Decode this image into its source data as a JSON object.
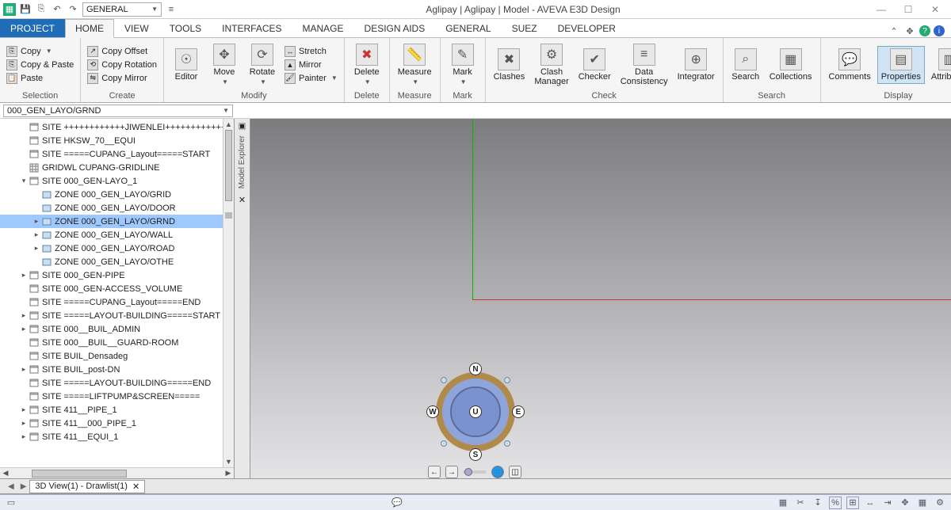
{
  "title": "Aglipay | Aglipay | Model - AVEVA E3D Design",
  "qat_dropdown": "GENERAL",
  "tabs": {
    "project": "PROJECT",
    "items": [
      "HOME",
      "VIEW",
      "TOOLS",
      "INTERFACES",
      "MANAGE",
      "DESIGN AIDS",
      "GENERAL",
      "SUEZ",
      "DEVELOPER"
    ],
    "active": 0
  },
  "ribbon": {
    "selection": {
      "label": "Selection",
      "copy": "Copy",
      "copypaste": "Copy & Paste",
      "paste": "Paste"
    },
    "create": {
      "label": "Create",
      "copyoffset": "Copy Offset",
      "copyrotation": "Copy Rotation",
      "copymirror": "Copy Mirror"
    },
    "modify": {
      "label": "Modify",
      "editor": "Editor",
      "move": "Move",
      "rotate": "Rotate",
      "stretch": "Stretch",
      "mirror": "Mirror",
      "painter": "Painter"
    },
    "delete": {
      "label": "Delete",
      "btn": "Delete"
    },
    "measure": {
      "label": "Measure",
      "btn": "Measure"
    },
    "mark": {
      "label": "Mark",
      "btn": "Mark"
    },
    "check": {
      "label": "Check",
      "clashes": "Clashes",
      "clashmgr": "Clash\nManager",
      "checker": "Checker",
      "datacons": "Data\nConsistency",
      "integrator": "Integrator"
    },
    "search": {
      "label": "Search",
      "search": "Search",
      "collections": "Collections"
    },
    "display": {
      "label": "Display",
      "comments": "Comments",
      "properties": "Properties",
      "attributes": "Attributes"
    }
  },
  "path": "000_GEN_LAYO/GRND",
  "sidepanel": {
    "label": "Model Explorer"
  },
  "tree": [
    {
      "d": 1,
      "t": "",
      "exp": "",
      "ic": "site",
      "label": "SITE ++++++++++++JIWENLEI++++++++++++"
    },
    {
      "d": 1,
      "t": "",
      "exp": "",
      "ic": "site",
      "label": "SITE HKSW_70__EQUI"
    },
    {
      "d": 1,
      "t": "",
      "exp": "",
      "ic": "site",
      "label": "SITE =====CUPANG_Layout=====START"
    },
    {
      "d": 1,
      "t": "",
      "exp": "",
      "ic": "grid",
      "label": "GRIDWL CUPANG-GRIDLINE"
    },
    {
      "d": 1,
      "t": "▾",
      "exp": "open",
      "ic": "site",
      "label": "SITE 000_GEN-LAYO_1"
    },
    {
      "d": 2,
      "t": "",
      "exp": "",
      "ic": "zone",
      "label": "ZONE 000_GEN_LAYO/GRID"
    },
    {
      "d": 2,
      "t": "",
      "exp": "",
      "ic": "zone",
      "label": "ZONE 000_GEN_LAYO/DOOR"
    },
    {
      "d": 2,
      "t": "▸",
      "exp": "closed",
      "ic": "zone",
      "label": "ZONE 000_GEN_LAYO/GRND",
      "sel": true
    },
    {
      "d": 2,
      "t": "▸",
      "exp": "closed",
      "ic": "zone",
      "label": "ZONE 000_GEN_LAYO/WALL"
    },
    {
      "d": 2,
      "t": "▸",
      "exp": "closed",
      "ic": "zone",
      "label": "ZONE 000_GEN_LAYO/ROAD"
    },
    {
      "d": 2,
      "t": "",
      "exp": "",
      "ic": "zone",
      "label": "ZONE 000_GEN_LAYO/OTHE"
    },
    {
      "d": 1,
      "t": "▸",
      "exp": "closed",
      "ic": "site",
      "label": "SITE 000_GEN-PIPE"
    },
    {
      "d": 1,
      "t": "",
      "exp": "",
      "ic": "site",
      "label": "SITE 000_GEN-ACCESS_VOLUME"
    },
    {
      "d": 1,
      "t": "",
      "exp": "",
      "ic": "site",
      "label": "SITE =====CUPANG_Layout=====END"
    },
    {
      "d": 1,
      "t": "▸",
      "exp": "closed",
      "ic": "site",
      "label": "SITE =====LAYOUT-BUILDING=====START"
    },
    {
      "d": 1,
      "t": "▸",
      "exp": "closed",
      "ic": "site",
      "label": "SITE 000__BUIL_ADMIN"
    },
    {
      "d": 1,
      "t": "",
      "exp": "",
      "ic": "site",
      "label": "SITE 000__BUIL__GUARD-ROOM"
    },
    {
      "d": 1,
      "t": "",
      "exp": "",
      "ic": "site",
      "label": "SITE BUIL_Densadeg"
    },
    {
      "d": 1,
      "t": "▸",
      "exp": "closed",
      "ic": "site",
      "label": "SITE BUIL_post-DN"
    },
    {
      "d": 1,
      "t": "",
      "exp": "",
      "ic": "site",
      "label": "SITE =====LAYOUT-BUILDING=====END"
    },
    {
      "d": 1,
      "t": "",
      "exp": "",
      "ic": "site",
      "label": "SITE =====LIFTPUMP&SCREEN====="
    },
    {
      "d": 1,
      "t": "▸",
      "exp": "closed",
      "ic": "site",
      "label": "SITE 411__PIPE_1"
    },
    {
      "d": 1,
      "t": "▸",
      "exp": "closed",
      "ic": "site",
      "label": "SITE 411__000_PIPE_1"
    },
    {
      "d": 1,
      "t": "▸",
      "exp": "closed",
      "ic": "site",
      "label": "SITE 411__EQUI_1"
    }
  ],
  "compass": {
    "n": "N",
    "s": "S",
    "e": "E",
    "w": "W",
    "u": "U"
  },
  "viewtab": "3D View(1) - Drawlist(1)"
}
